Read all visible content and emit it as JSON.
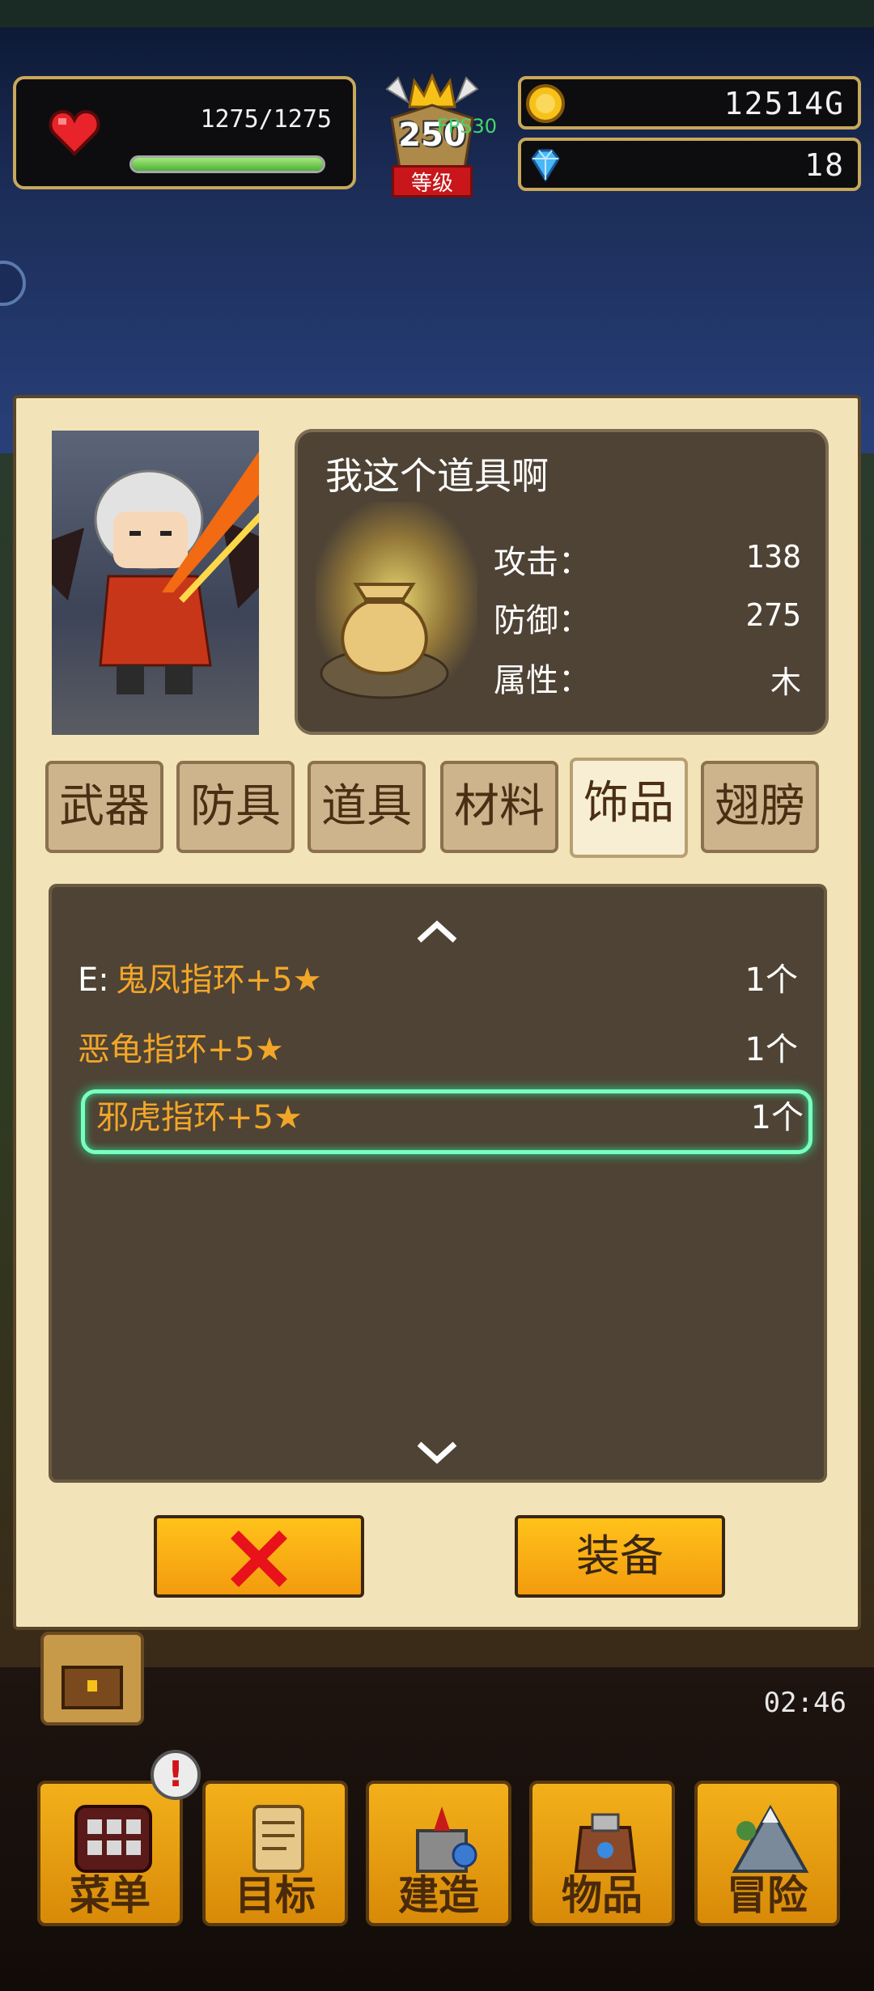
{
  "hud": {
    "hp_text": "1275/1275",
    "hp_fraction": 1.0,
    "level": "250",
    "level_label": "等级",
    "fps": "FPS30",
    "gold": "12514G",
    "gems": "18"
  },
  "item_detail": {
    "name": "我这个道具啊",
    "stats": [
      {
        "label": "攻击：",
        "value": "138"
      },
      {
        "label": "防御：",
        "value": "275"
      },
      {
        "label": "属性：",
        "value": "木"
      }
    ]
  },
  "tabs": [
    {
      "label": "武器",
      "active": false
    },
    {
      "label": "防具",
      "active": false
    },
    {
      "label": "道具",
      "active": false
    },
    {
      "label": "材料",
      "active": false
    },
    {
      "label": "饰品",
      "active": true
    },
    {
      "label": "翅膀",
      "active": false
    }
  ],
  "items": [
    {
      "equipped_prefix": "E:",
      "name": "鬼凤指环+5★",
      "qty": "1个"
    },
    {
      "equipped_prefix": "",
      "name": "恶龟指环+5★",
      "qty": "1个"
    },
    {
      "equipped_prefix": "",
      "name": "邪虎指环+5★",
      "qty": "1个",
      "selected": true
    }
  ],
  "buttons": {
    "equip_label": "装备"
  },
  "timer": "02:46",
  "nav": [
    {
      "label": "菜单",
      "icon": "menu-grid-icon"
    },
    {
      "label": "目标",
      "icon": "quest-scroll-icon"
    },
    {
      "label": "建造",
      "icon": "castle-icon"
    },
    {
      "label": "物品",
      "icon": "bag-icon"
    },
    {
      "label": "冒险",
      "icon": "mountain-icon"
    }
  ],
  "alert_mark": "!",
  "colors": {
    "accent_orange": "#f2a628",
    "button_yellow": "#ffc21a",
    "selection_green": "#7affc2",
    "panel_bg": "#f3e3b8",
    "dark_box": "#4e4335"
  }
}
